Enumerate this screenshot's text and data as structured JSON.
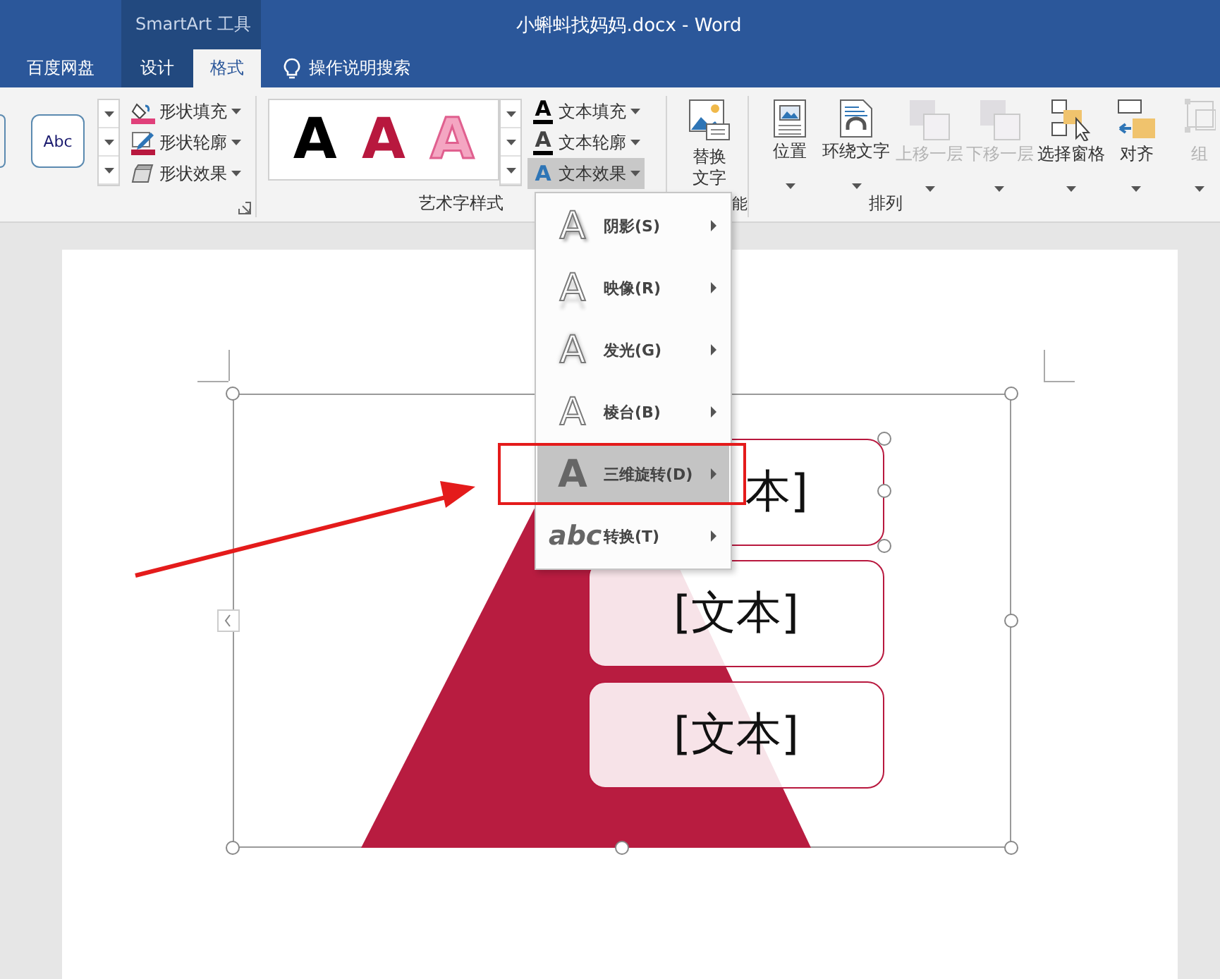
{
  "window": {
    "title": "小蝌蚪找妈妈.docx  -  Word",
    "context_group": "SmartArt 工具"
  },
  "tabs": [
    {
      "label": "百度网盘",
      "selected": false,
      "kind": "plain"
    },
    {
      "label": "设计",
      "selected": false,
      "kind": "context"
    },
    {
      "label": "格式",
      "selected": true,
      "kind": "context"
    }
  ],
  "tell_me": {
    "label": "操作说明搜索"
  },
  "ribbon": {
    "shape_styles": {
      "gallery_sample": "Abc",
      "commands": [
        {
          "label": "形状填充",
          "kind": "fill"
        },
        {
          "label": "形状轮廓",
          "kind": "outline"
        },
        {
          "label": "形状效果",
          "kind": "effect"
        }
      ]
    },
    "wordart_styles": {
      "label": "艺术字样式",
      "gallery": [
        {
          "glyph": "A",
          "color": "#000000",
          "kind": "solid"
        },
        {
          "glyph": "A",
          "color": "#b8183e",
          "kind": "solid"
        },
        {
          "glyph": "A",
          "color": "#f4a6c2",
          "kind": "outlined"
        }
      ],
      "commands": [
        {
          "glyph": "A",
          "label": "文本填充",
          "kind": "fill",
          "selected": false
        },
        {
          "glyph": "A",
          "label": "文本轮廓",
          "kind": "outline",
          "selected": false
        },
        {
          "glyph": "A",
          "label": "文本效果",
          "kind": "effect",
          "selected": true
        }
      ]
    },
    "accessibility": {
      "button": "替换文字",
      "label": "能"
    },
    "arrange": {
      "label": "排列",
      "buttons": [
        {
          "label": "位置",
          "kind": "position",
          "disabled": false
        },
        {
          "label": "环绕文字",
          "kind": "wrap",
          "disabled": false
        },
        {
          "label": "上移一层",
          "kind": "forward",
          "disabled": true
        },
        {
          "label": "下移一层",
          "kind": "backward",
          "disabled": true
        },
        {
          "label": "选择窗格",
          "kind": "pane",
          "disabled": false
        },
        {
          "label": "对齐",
          "kind": "align",
          "disabled": false
        },
        {
          "label": "组",
          "kind": "group",
          "disabled": true
        }
      ]
    }
  },
  "menu": {
    "items": [
      {
        "glyph": "A",
        "label": "阴影(S)",
        "kind": "shadow",
        "selected": false
      },
      {
        "glyph": "A",
        "label": "映像(R)",
        "kind": "reflection",
        "selected": false
      },
      {
        "glyph": "A",
        "label": "发光(G)",
        "kind": "glow",
        "selected": false
      },
      {
        "glyph": "A",
        "label": "棱台(B)",
        "kind": "bevel",
        "selected": false
      },
      {
        "glyph": "A",
        "label": "三维旋转(D)",
        "kind": "rotation",
        "selected": true
      },
      {
        "glyph": "abc",
        "label": "转换(T)",
        "kind": "transform",
        "selected": false
      }
    ]
  },
  "smartart": {
    "shapes": [
      {
        "text": "本]",
        "selected": true
      },
      {
        "text": "[文本]",
        "selected": false
      },
      {
        "text": "[文本]",
        "selected": false
      }
    ]
  }
}
